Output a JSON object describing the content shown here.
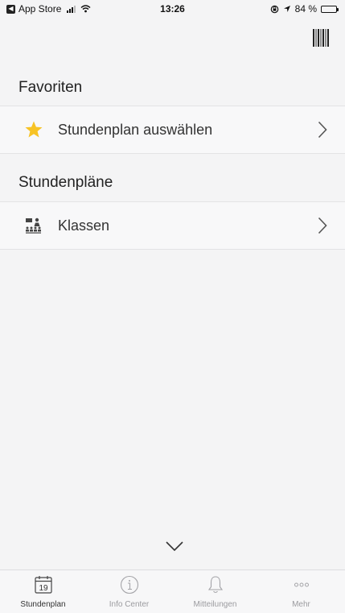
{
  "status_bar": {
    "back_app": "App Store",
    "time": "13:26",
    "battery_text": "84 %",
    "battery_level": 0.84
  },
  "sections": [
    {
      "title": "Favoriten",
      "rows": [
        {
          "label": "Stundenplan auswählen",
          "icon": "star-icon"
        }
      ]
    },
    {
      "title": "Stundenpläne",
      "rows": [
        {
          "label": "Klassen",
          "icon": "classes-icon"
        }
      ]
    }
  ],
  "tab_bar": {
    "tabs": [
      {
        "label": "Stundenplan",
        "icon": "calendar-icon",
        "calendar_day": "19",
        "active": true
      },
      {
        "label": "Info Center",
        "icon": "info-icon",
        "active": false
      },
      {
        "label": "Mitteilungen",
        "icon": "bell-icon",
        "active": false
      },
      {
        "label": "Mehr",
        "icon": "more-icon",
        "active": false
      }
    ]
  },
  "colors": {
    "accent_star": "#f7c325",
    "background": "#f4f4f5",
    "row_background": "#f8f8f9",
    "tab_inactive": "#9b9b9f"
  }
}
